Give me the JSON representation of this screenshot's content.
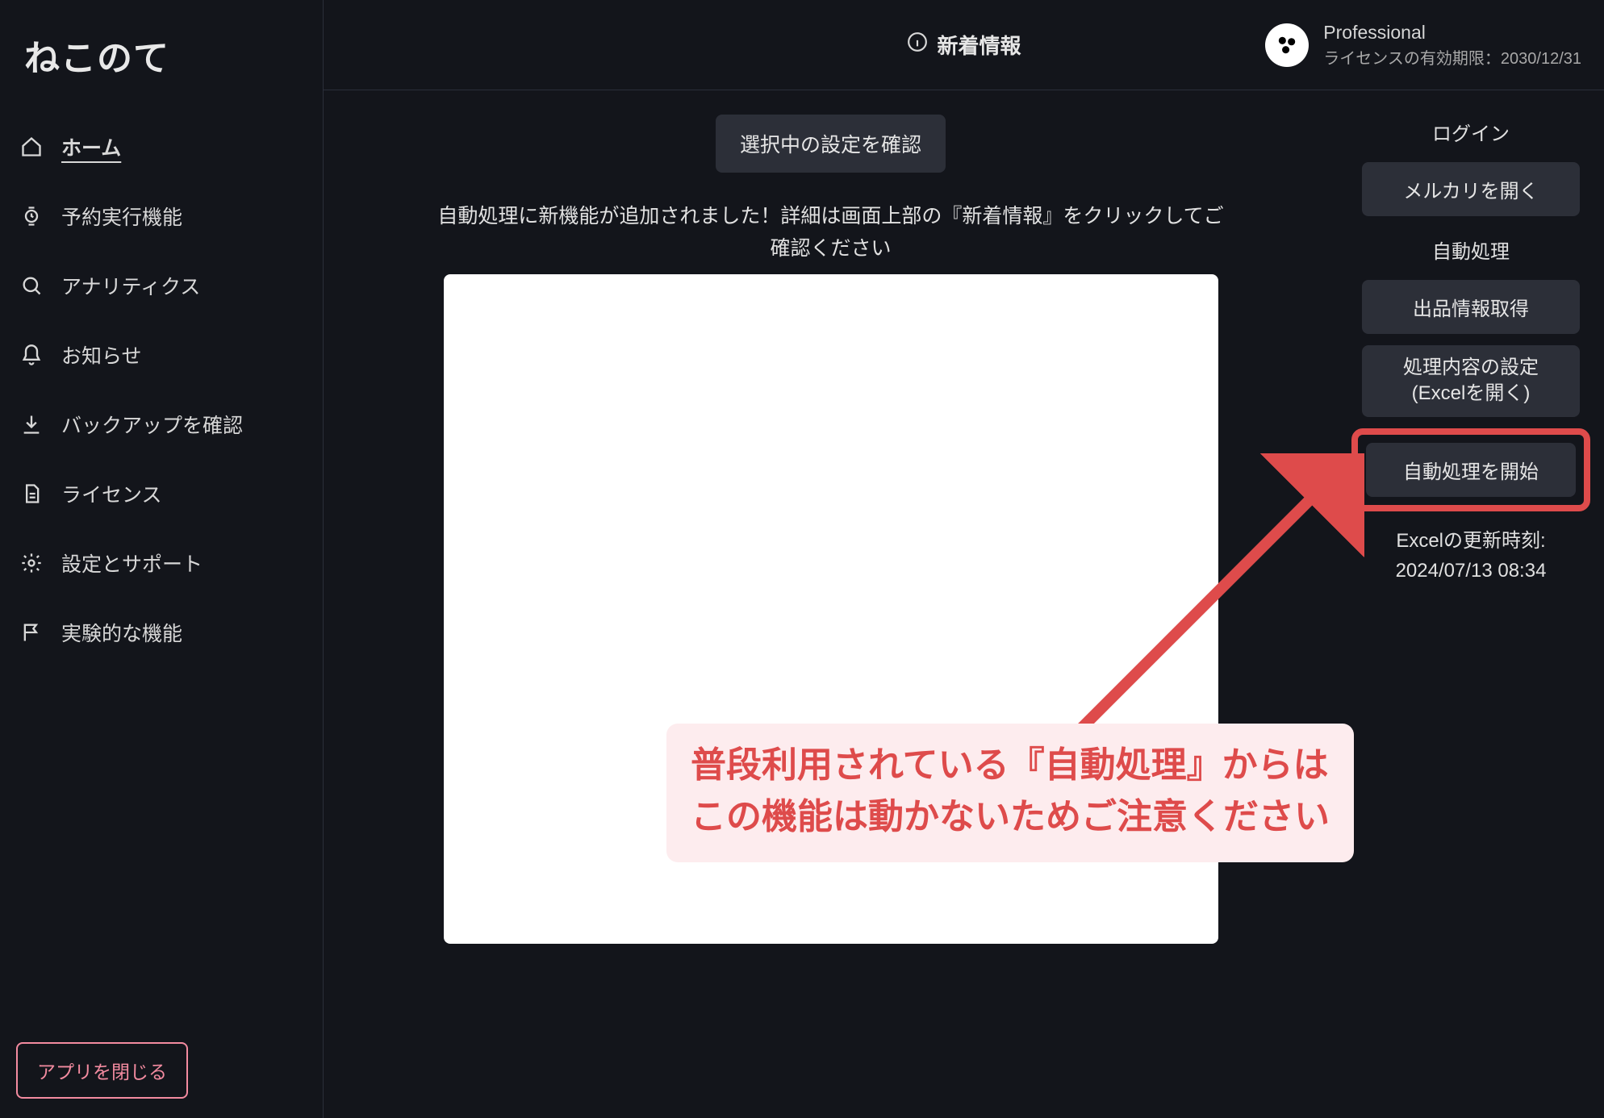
{
  "app": {
    "name": "ねこのて"
  },
  "sidebar": {
    "items": [
      {
        "label": "ホーム",
        "icon": "home-icon",
        "active": true
      },
      {
        "label": "予約実行機能",
        "icon": "watch-icon",
        "active": false
      },
      {
        "label": "アナリティクス",
        "icon": "search-icon",
        "active": false
      },
      {
        "label": "お知らせ",
        "icon": "bell-icon",
        "active": false
      },
      {
        "label": "バックアップを確認",
        "icon": "download-icon",
        "active": false
      },
      {
        "label": "ライセンス",
        "icon": "document-icon",
        "active": false
      },
      {
        "label": "設定とサポート",
        "icon": "gear-icon",
        "active": false
      },
      {
        "label": "実験的な機能",
        "icon": "flag-icon",
        "active": false
      }
    ],
    "close_app_label": "アプリを閉じる"
  },
  "topbar": {
    "news_label": "新着情報",
    "license_name": "Professional",
    "license_expiry": "ライセンスの有効期限：2030/12/31"
  },
  "main": {
    "confirm_settings_label": "選択中の設定を確認",
    "notice": "自動処理に新機能が追加されました！詳細は画面上部の『新着情報』をクリックしてご確認ください"
  },
  "right_panel": {
    "login_label": "ログイン",
    "open_mercari_label": "メルカリを開く",
    "auto_process_label": "自動処理",
    "fetch_listing_label": "出品情報取得",
    "process_settings_label_1": "処理内容の設定",
    "process_settings_label_2": "(Excelを開く)",
    "start_auto_label": "自動処理を開始",
    "excel_time_label": "Excelの更新時刻:",
    "excel_time_value": "2024/07/13 08:34"
  },
  "annotation": {
    "line1": "普段利用されている『自動処理』からは",
    "line2": "この機能は動かないためご注意ください"
  },
  "colors": {
    "accent_red": "#de4b4b",
    "sidebar_close_border": "#f38ba0",
    "button_bg": "#2c2f38",
    "bg": "#13151b"
  }
}
